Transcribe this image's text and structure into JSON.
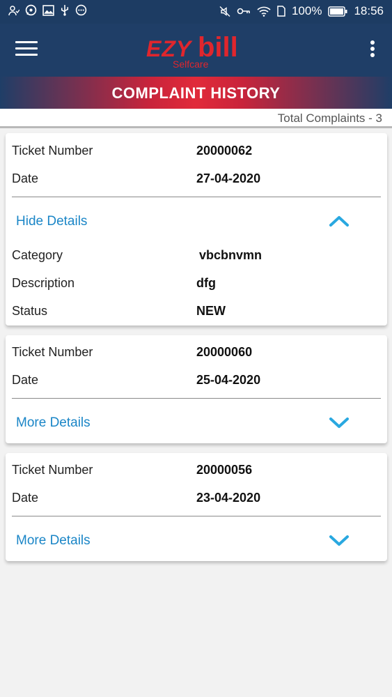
{
  "status_bar": {
    "battery_percent": "100%",
    "time": "18:56"
  },
  "app_bar": {
    "logo": {
      "ezy": "EZY",
      "bill": "bill",
      "tagline": "Selfcare"
    }
  },
  "page": {
    "title": "COMPLAINT HISTORY",
    "total": "Total Complaints - 3"
  },
  "labels": {
    "ticket_number": "Ticket Number",
    "date": "Date",
    "category": "Category",
    "description": "Description",
    "status": "Status"
  },
  "complaints": [
    {
      "ticket_number": "20000062",
      "date": "27-04-2020",
      "toggle_label": "Hide Details",
      "expanded": true,
      "category": "vbcbnvmn",
      "description": "dfg",
      "status": "NEW"
    },
    {
      "ticket_number": "20000060",
      "date": "25-04-2020",
      "toggle_label": "More Details",
      "expanded": false
    },
    {
      "ticket_number": "20000056",
      "date": "23-04-2020",
      "toggle_label": "More Details",
      "expanded": false
    }
  ],
  "colors": {
    "header": "#1f3e67",
    "brand_red": "#e0262d",
    "link_blue": "#1b86c7",
    "chevron_blue": "#29a8e0"
  },
  "icons": {
    "menu": "hamburger-menu-icon",
    "overflow": "more-vertical-icon",
    "collapse": "chevron-up-icon",
    "expand": "chevron-down-icon"
  }
}
